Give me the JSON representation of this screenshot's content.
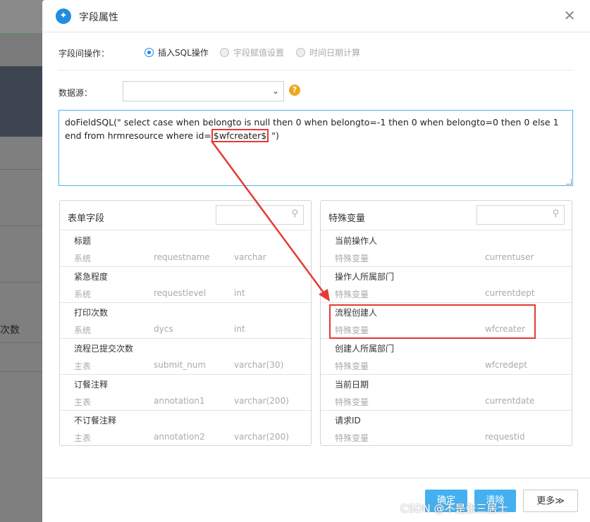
{
  "background": {
    "side_text": "次数"
  },
  "dialog": {
    "title": "字段属性",
    "logo_glyph": "✦"
  },
  "operation": {
    "label": "字段间操作：",
    "options": [
      "插入SQL操作",
      "字段赋值设置",
      "时间日期计算"
    ],
    "selected": "插入SQL操作"
  },
  "datasource": {
    "label": "数据源：",
    "value": "",
    "help_glyph": "?"
  },
  "sql": {
    "prefix": "doFieldSQL(\" select case when belongto is null then 0 when belongto=-1 then 0  when belongto=0 then 0 else 1 end from hrmresource where id=",
    "variable": "$wfcreater$",
    "suffix": " \")"
  },
  "form_fields": {
    "title": "表单字段",
    "items": [
      {
        "name": "标题",
        "category": "系统",
        "field": "requestname",
        "type": "varchar"
      },
      {
        "name": "紧急程度",
        "category": "系统",
        "field": "requestlevel",
        "type": "int"
      },
      {
        "name": "打印次数",
        "category": "系统",
        "field": "dycs",
        "type": "int"
      },
      {
        "name": "流程已提交次数",
        "category": "主表",
        "field": "submit_num",
        "type": "varchar(30)"
      },
      {
        "name": "订餐注释",
        "category": "主表",
        "field": "annotation1",
        "type": "varchar(200)"
      },
      {
        "name": "不订餐注释",
        "category": "主表",
        "field": "annotation2",
        "type": "varchar(200)"
      }
    ]
  },
  "special_vars": {
    "title": "特殊变量",
    "items": [
      {
        "name": "当前操作人",
        "category": "特殊变量",
        "var": "currentuser"
      },
      {
        "name": "操作人所属部门",
        "category": "特殊变量",
        "var": "currentdept"
      },
      {
        "name": "流程创建人",
        "category": "特殊变量",
        "var": "wfcreater"
      },
      {
        "name": "创建人所属部门",
        "category": "特殊变量",
        "var": "wfcredept"
      },
      {
        "name": "当前日期",
        "category": "特殊变量",
        "var": "currentdate"
      },
      {
        "name": "请求ID",
        "category": "特殊变量",
        "var": "requestid"
      }
    ]
  },
  "footer": {
    "ok": "确定",
    "clear": "清除",
    "more": "更多≫"
  },
  "watermark": "CSDN @不是张三居士",
  "colors": {
    "accent": "#44b0f0",
    "highlight": "#e53935",
    "help": "#f0a61f"
  }
}
